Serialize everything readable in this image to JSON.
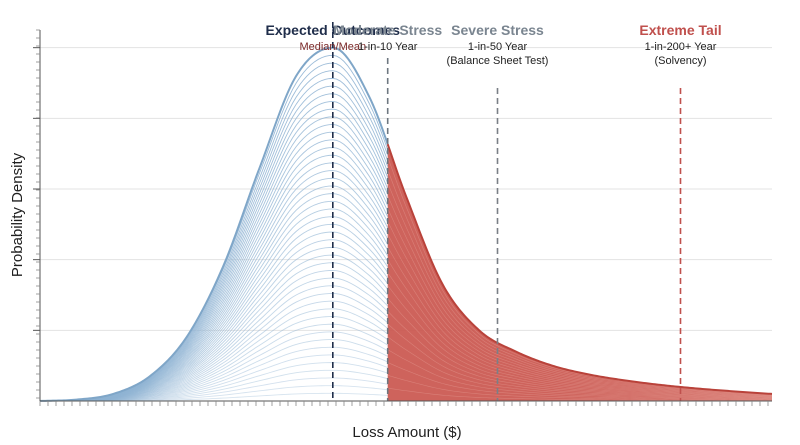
{
  "chart_data": {
    "type": "area",
    "title": "",
    "xlabel": "Loss Amount ($)",
    "ylabel": "Probability Density",
    "xlim": [
      0,
      100
    ],
    "ylim": [
      0,
      1.05
    ],
    "grid": "horizontal",
    "colors": {
      "body": "#8fb3d3",
      "tail": "#c9524a",
      "expected_line": "#1f2d4a",
      "moderate_line": "#6e7780",
      "severe_line": "#7a7f86",
      "extreme_line": "#c0504d",
      "expected_label": "#1f2d4a",
      "expected_sub": "#7a2828",
      "moderate_label": "#7a8590",
      "severe_label": "#7a8590",
      "extreme_label": "#c0504d",
      "neutral_sub": "#222222"
    },
    "curve": {
      "x": [
        0,
        5,
        10,
        15,
        20,
        25,
        30,
        35,
        40,
        45,
        50,
        55,
        60,
        65,
        70,
        75,
        80,
        85,
        90,
        95,
        100
      ],
      "y": [
        0.0,
        0.004,
        0.02,
        0.07,
        0.18,
        0.38,
        0.66,
        0.92,
        1.0,
        0.86,
        0.58,
        0.33,
        0.2,
        0.14,
        0.1,
        0.075,
        0.058,
        0.045,
        0.035,
        0.027,
        0.02
      ]
    },
    "tail_start_x": 47.5,
    "thresholds": [
      {
        "name": "Expected Outcomes",
        "sub": [
          "Median/Mean"
        ],
        "x": 40
      },
      {
        "name": "Moderate Stress",
        "sub": [
          "1-in-10 Year"
        ],
        "x": 47.5
      },
      {
        "name": "Severe Stress",
        "sub": [
          "1-in-50 Year",
          "(Balance Sheet Test)"
        ],
        "x": 62.5
      },
      {
        "name": "Extreme Tail",
        "sub": [
          "1-in-200+ Year",
          "(Solvency)"
        ],
        "x": 87.5
      }
    ]
  }
}
